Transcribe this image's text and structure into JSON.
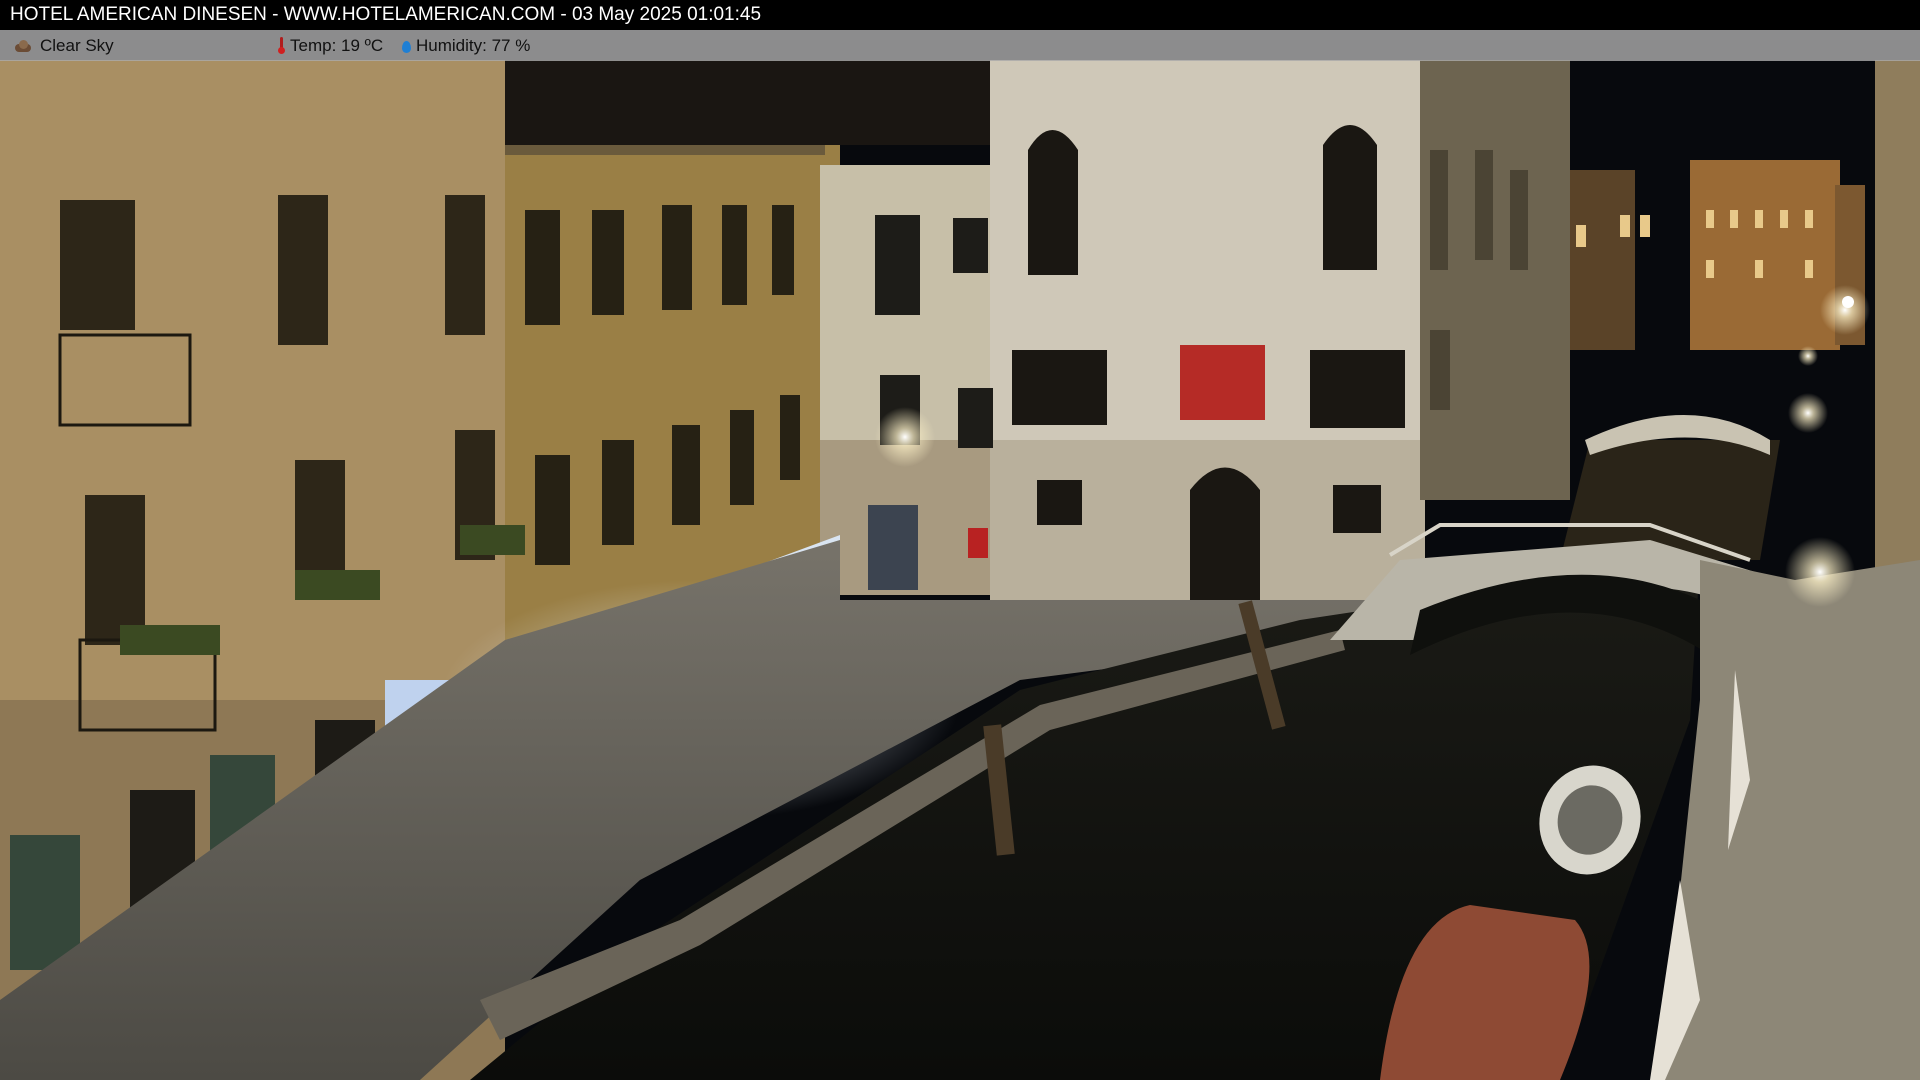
{
  "header": {
    "title": "HOTEL AMERICAN DINESEN - WWW.HOTELAMERICAN.COM - 03 May 2025 01:01:45"
  },
  "weather": {
    "condition": "Clear Sky",
    "condition_icon": "cloud-icon",
    "temperature": "Temp: 19 ºC",
    "temperature_icon": "thermometer-icon",
    "humidity": "Humidity: 77 %",
    "humidity_icon": "water-drop-icon"
  },
  "colors": {
    "title_bar": "#000000",
    "weather_bar": "#aaaaaa",
    "night_sky": "#07090d"
  }
}
